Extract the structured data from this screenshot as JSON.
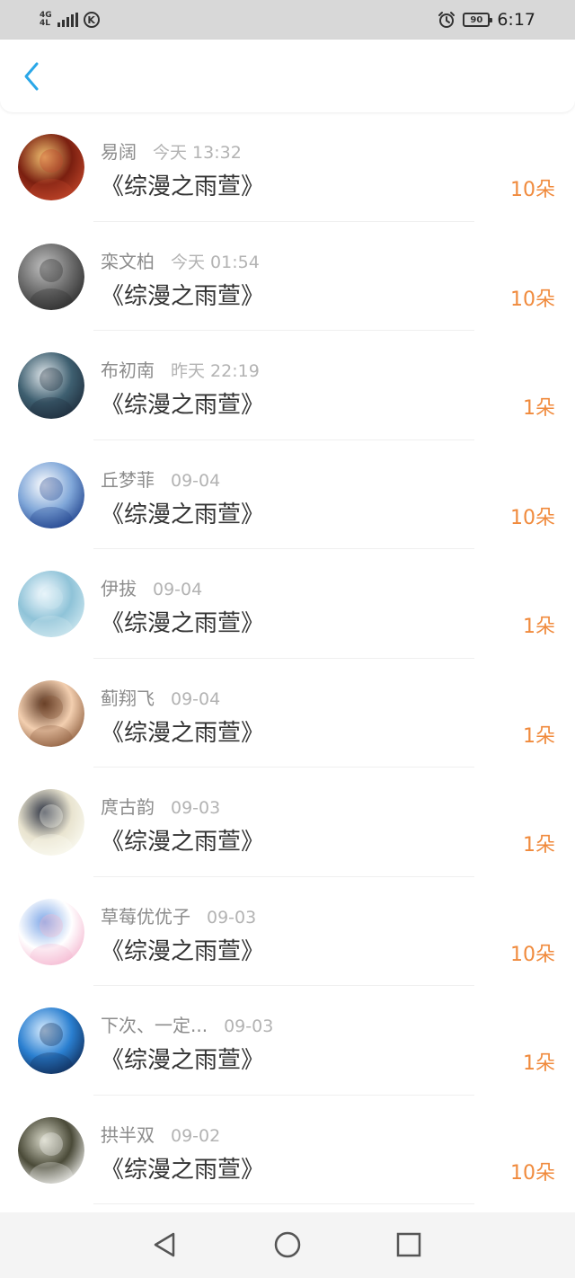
{
  "status_bar": {
    "network_type_top": "4G",
    "network_type_bottom": "4L",
    "carrier_badge": "K",
    "battery_level": "90",
    "time": "6:17"
  },
  "header": {
    "back_icon": "chevron-left-icon",
    "accent_color": "#2aa7e8"
  },
  "gift_unit": "朵",
  "records": [
    {
      "name": "易阔",
      "time": "今天 13:32",
      "book": "《综漫之雨萱》",
      "count": "10朵"
    },
    {
      "name": "栾文柏",
      "time": "今天 01:54",
      "book": "《综漫之雨萱》",
      "count": "10朵"
    },
    {
      "name": "布初南",
      "time": "昨天 22:19",
      "book": "《综漫之雨萱》",
      "count": "1朵"
    },
    {
      "name": "丘梦菲",
      "time": "09-04",
      "book": "《综漫之雨萱》",
      "count": "10朵"
    },
    {
      "name": "伊拔",
      "time": "09-04",
      "book": "《综漫之雨萱》",
      "count": "1朵"
    },
    {
      "name": "蓟翔飞",
      "time": "09-04",
      "book": "《综漫之雨萱》",
      "count": "1朵"
    },
    {
      "name": "庹古韵",
      "time": "09-03",
      "book": "《综漫之雨萱》",
      "count": "1朵"
    },
    {
      "name": "草莓优优子",
      "time": "09-03",
      "book": "《综漫之雨萱》",
      "count": "10朵"
    },
    {
      "name": "下次、一定...",
      "time": "09-03",
      "book": "《综漫之雨萱》",
      "count": "1朵"
    },
    {
      "name": "拱半双",
      "time": "09-02",
      "book": "《综漫之雨萱》",
      "count": "10朵"
    }
  ],
  "avatar_colors": [
    [
      "#c2462a",
      "#7a1f10",
      "#f0c070"
    ],
    [
      "#2b2b2b",
      "#6b6b6b",
      "#bfbfbf"
    ],
    [
      "#1d2b3a",
      "#3e5f70",
      "#dfe6ea"
    ],
    [
      "#1d3f8a",
      "#7fa6d8",
      "#ffffff"
    ],
    [
      "#cfe8f0",
      "#8fc3d8",
      "#f6fbff"
    ],
    [
      "#8a5a3a",
      "#f3cfb0",
      "#5a3520"
    ],
    [
      "#fbfbf3",
      "#e9e4d0",
      "#2a3040"
    ],
    [
      "#f4b6cf",
      "#ffffff",
      "#7fa8e8"
    ],
    [
      "#0f2a55",
      "#2a7fd0",
      "#dbeeff"
    ],
    [
      "#f3f3f0",
      "#4a4a38",
      "#d8d8c8"
    ]
  ],
  "colors": {
    "name": "#8c8c8c",
    "time": "#b3b3b3",
    "title": "#333333",
    "count": "#f08a3c"
  },
  "nav_bar": {
    "back_icon": "triangle-back-icon",
    "home_icon": "circle-home-icon",
    "recents_icon": "square-recents-icon"
  }
}
